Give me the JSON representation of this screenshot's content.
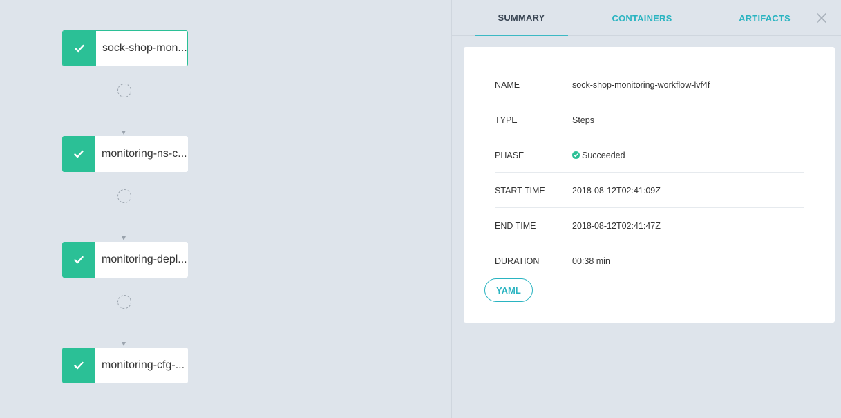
{
  "graph": {
    "nodes": [
      {
        "label": "sock-shop-mon...",
        "status": "succeeded"
      },
      {
        "label": "monitoring-ns-c...",
        "status": "succeeded"
      },
      {
        "label": "monitoring-depl...",
        "status": "succeeded"
      },
      {
        "label": "monitoring-cfg-...",
        "status": "succeeded"
      }
    ]
  },
  "panel": {
    "tabs": {
      "summary": "SUMMARY",
      "containers": "CONTAINERS",
      "artifacts": "ARTIFACTS"
    },
    "active_tab": "SUMMARY",
    "summary": {
      "rows": [
        {
          "key": "NAME",
          "value": "sock-shop-monitoring-workflow-lvf4f"
        },
        {
          "key": "TYPE",
          "value": "Steps"
        },
        {
          "key": "PHASE",
          "value": "Succeeded"
        },
        {
          "key": "START TIME",
          "value": "2018-08-12T02:41:09Z"
        },
        {
          "key": "END TIME",
          "value": "2018-08-12T02:41:47Z"
        },
        {
          "key": "DURATION",
          "value": "00:38 min"
        }
      ],
      "yaml_button": "YAML"
    }
  },
  "colors": {
    "success": "#2bc096",
    "accent": "#2ab4c1",
    "background": "#dee4eb"
  },
  "icons": {
    "node_status": "check-icon",
    "close": "close-icon",
    "phase": "check-circle-icon"
  }
}
